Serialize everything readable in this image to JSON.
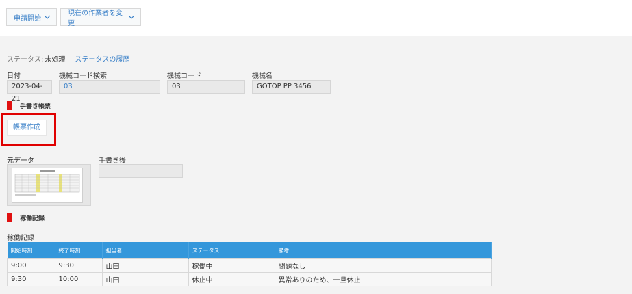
{
  "toolbar": {
    "start_request": "申請開始",
    "change_assignee": "現在の作業者を変更"
  },
  "status": {
    "label": "ステータス:",
    "value": "未処理",
    "history_link": "ステータスの履歴"
  },
  "fields": {
    "date": {
      "label": "日付",
      "value": "2023-04-21"
    },
    "machine_code_search": {
      "label": "機械コード検索",
      "value": "03"
    },
    "machine_code": {
      "label": "機械コード",
      "value": "03"
    },
    "machine_name": {
      "label": "機械名",
      "value": "GOTOP PP 3456"
    }
  },
  "handwritten_section": {
    "title": "手書き帳票",
    "create_button": "帳票作成",
    "original_label": "元データ",
    "after_label": "手書き後"
  },
  "operation_section": {
    "title": "稼働記録",
    "table_label": "稼働記録",
    "columns": [
      "開始時刻",
      "終了時刻",
      "担当者",
      "ステータス",
      "備考"
    ],
    "rows": [
      [
        "9:00",
        "9:30",
        "山田",
        "稼働中",
        "問題なし"
      ],
      [
        "9:30",
        "10:00",
        "山田",
        "休止中",
        "異常ありのため、一旦休止"
      ]
    ]
  },
  "colors": {
    "accent": "#3a80c8",
    "table_header": "#3497db",
    "section_marker": "#e01010",
    "highlight": "#e00000"
  },
  "icons": {
    "dropdown": "chevron-down-icon",
    "thumbnail": "document-thumbnail"
  }
}
